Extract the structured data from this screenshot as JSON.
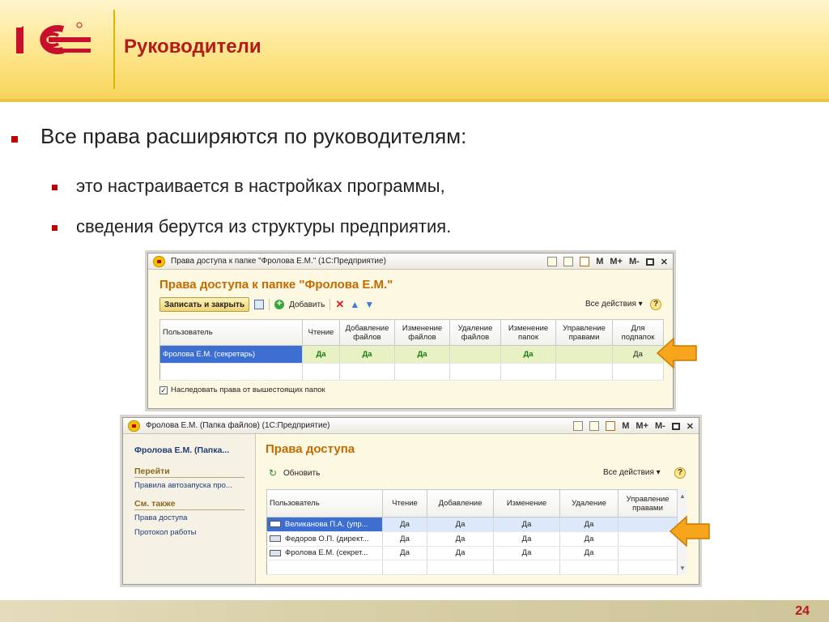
{
  "slide": {
    "title": "Руководители",
    "page_number": "24",
    "bullets": [
      "Все права расширяются по руководителям:",
      "это настраивается в настройках программы,",
      "сведения берутся из структуры предприятия."
    ]
  },
  "window1": {
    "title": "Права доступа к папке \"Фролова Е.М.\" (1С:Предприятие)",
    "heading": "Права доступа к папке \"Фролова Е.М.\"",
    "toolbar": {
      "save_close": "Записать и закрыть",
      "add": "Добавить",
      "all_actions": "Все действия"
    },
    "title_buttons": [
      "M",
      "M+",
      "M-"
    ],
    "columns": [
      "Пользователь",
      "Чтение",
      "Добавление файлов",
      "Изменение файлов",
      "Удаление файлов",
      "Изменение папок",
      "Управление правами",
      "Для подпапок"
    ],
    "rows": [
      [
        "Фролова Е.М. (секретарь)",
        "Да",
        "Да",
        "Да",
        "",
        "Да",
        "",
        "Да"
      ]
    ],
    "inherit_label": "Наследовать права от вышестоящих папок"
  },
  "window2": {
    "title": "Фролова Е.М. (Папка файлов) (1С:Предприятие)",
    "title_buttons": [
      "M",
      "M+",
      "M-"
    ],
    "side": {
      "title": "Фролова Е.М. (Папка...",
      "goto_label": "Перейти",
      "goto_links": [
        "Правила автозапуска про..."
      ],
      "see_also_label": "См. также",
      "see_also_links": [
        "Права доступа",
        "Протокол работы"
      ]
    },
    "heading": "Права доступа",
    "toolbar": {
      "refresh": "Обновить",
      "all_actions": "Все действия"
    },
    "columns": [
      "Пользователь",
      "Чтение",
      "Добавление",
      "Изменение",
      "Удаление",
      "Управление правами"
    ],
    "rows": [
      [
        "Великанова П.А. (упр...",
        "Да",
        "Да",
        "Да",
        "Да",
        ""
      ],
      [
        "Федоров О.П. (директ...",
        "Да",
        "Да",
        "Да",
        "Да",
        ""
      ],
      [
        "Фролова Е.М. (секрет...",
        "Да",
        "Да",
        "Да",
        "Да",
        ""
      ]
    ]
  },
  "colors": {
    "title_red": "#b31b1b",
    "bullet_red": "#c00000",
    "heading_orange": "#c46a00",
    "arrow_orange": "#f7a51c"
  }
}
